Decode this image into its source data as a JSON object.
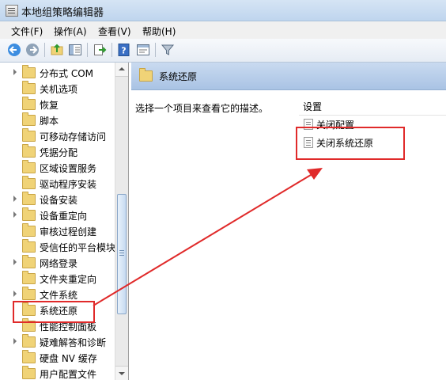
{
  "window": {
    "title": "本地组策略编辑器"
  },
  "menu": [
    "文件(F)",
    "操作(A)",
    "查看(V)",
    "帮助(H)"
  ],
  "toolbar": {
    "icons": [
      "back-icon",
      "forward-icon",
      "up-folder-icon",
      "show-hide-tree-icon",
      "export-list-icon",
      "help-icon",
      "properties-icon",
      "filter-icon"
    ]
  },
  "tree": {
    "items": [
      {
        "label": "分布式 COM",
        "expandable": true
      },
      {
        "label": "关机选项",
        "expandable": false
      },
      {
        "label": "恢复",
        "expandable": false
      },
      {
        "label": "脚本",
        "expandable": false
      },
      {
        "label": "可移动存储访问",
        "expandable": false
      },
      {
        "label": "凭据分配",
        "expandable": false
      },
      {
        "label": "区域设置服务",
        "expandable": false
      },
      {
        "label": "驱动程序安装",
        "expandable": false
      },
      {
        "label": "设备安装",
        "expandable": true
      },
      {
        "label": "设备重定向",
        "expandable": true
      },
      {
        "label": "审核过程创建",
        "expandable": false
      },
      {
        "label": "受信任的平台模块",
        "expandable": false
      },
      {
        "label": "网络登录",
        "expandable": true
      },
      {
        "label": "文件夹重定向",
        "expandable": false
      },
      {
        "label": "文件系统",
        "expandable": true
      },
      {
        "label": "系统还原",
        "expandable": false,
        "highlighted": true
      },
      {
        "label": "性能控制面板",
        "expandable": false
      },
      {
        "label": "疑难解答和诊断",
        "expandable": true
      },
      {
        "label": "硬盘 NV 缓存",
        "expandable": false
      },
      {
        "label": "用户配置文件",
        "expandable": false
      }
    ]
  },
  "right_pane": {
    "title": "系统还原",
    "description": "选择一个项目来查看它的描述。",
    "column_header": "设置",
    "settings": [
      {
        "label": "关闭配置"
      },
      {
        "label": "关闭系统还原",
        "highlighted": true
      }
    ]
  },
  "annotation": {
    "color": "#e02a2a"
  }
}
